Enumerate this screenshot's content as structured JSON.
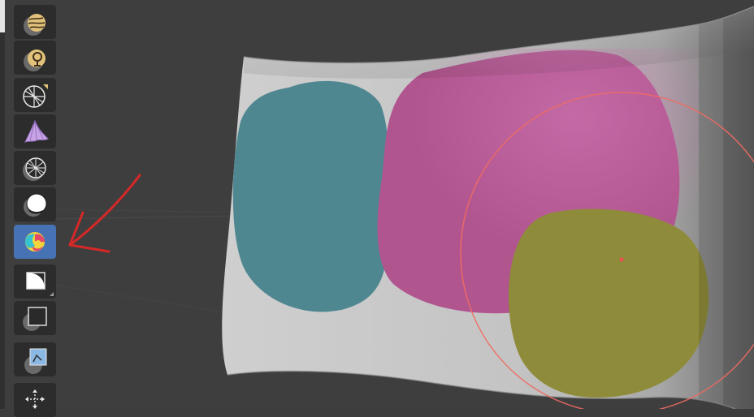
{
  "app": {
    "mode": "Texture Paint",
    "active_tool": "draw-tool"
  },
  "colors": {
    "viewport_bg": "#3e3e3e",
    "tool_bg": "#2c2c2c",
    "tool_active": "#4772b3",
    "brush_circle": "#ef6a63",
    "annotation_arrow": "#d62828",
    "paint_teal": "#4f8791",
    "paint_magenta": "#b1558f",
    "paint_olive": "#8e8b3a",
    "mesh_base": "#bdbdbd"
  },
  "toolbar": {
    "tools": [
      {
        "name": "smear-tool",
        "icon": "smear-icon",
        "active": false
      },
      {
        "name": "clone-tool",
        "icon": "clone-stamp-icon",
        "active": false
      },
      {
        "name": "transform-tool",
        "icon": "sphere-transform-icon",
        "active": false
      },
      {
        "name": "fill-tool",
        "icon": "fill-bucket-icon",
        "active": false
      },
      {
        "name": "mask-tool",
        "icon": "mask-sphere-icon",
        "active": false
      },
      {
        "name": "soften-tool",
        "icon": "soften-icon",
        "active": false
      },
      {
        "name": "draw-tool",
        "icon": "draw-paint-icon",
        "active": true
      },
      {
        "name": "box-select-tool",
        "icon": "box-select-icon",
        "active": false
      },
      {
        "name": "rectangle-tool",
        "icon": "rectangle-icon",
        "active": false
      },
      {
        "name": "annotate-tool",
        "icon": "annotate-icon",
        "active": false
      },
      {
        "name": "move-tool",
        "icon": "move-icon",
        "active": false
      }
    ]
  }
}
